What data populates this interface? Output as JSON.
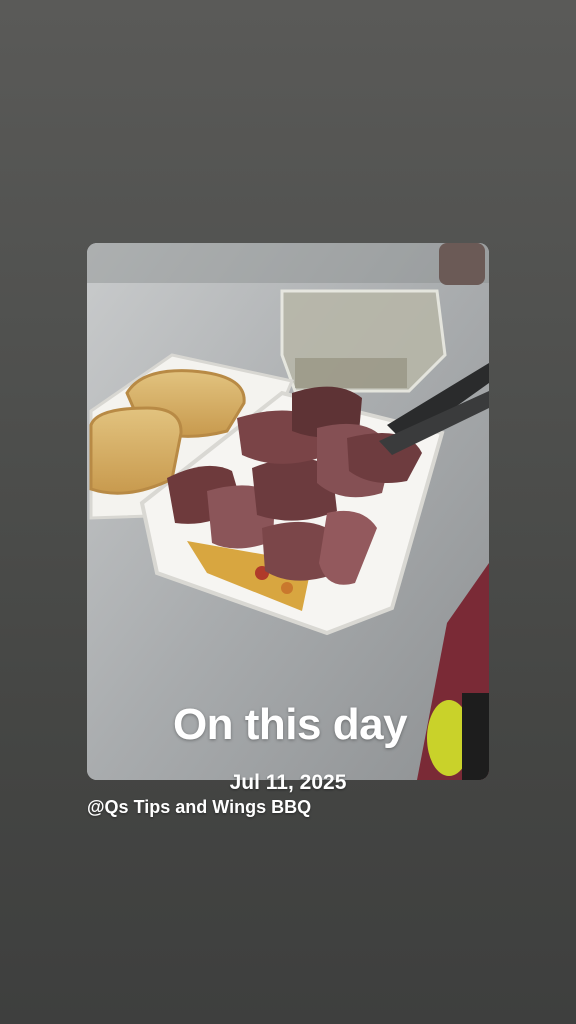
{
  "story": {
    "title": "On this day",
    "date": "Jul 11, 2025",
    "mention": "@Qs Tips and Wings BBQ"
  },
  "colors": {
    "background": "#4e4f4d",
    "text": "#ffffff"
  }
}
